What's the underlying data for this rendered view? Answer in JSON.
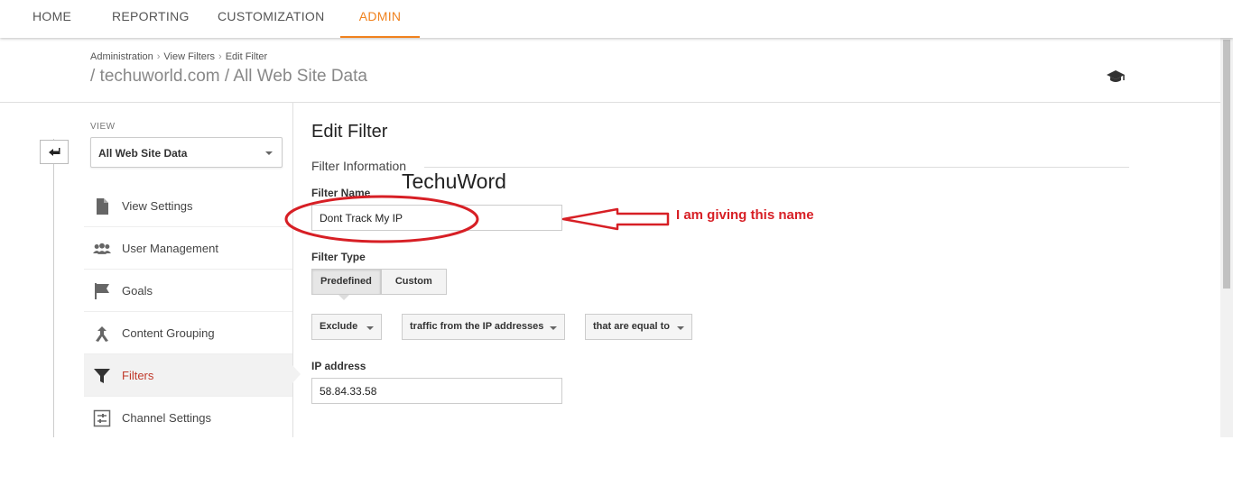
{
  "nav": {
    "tabs": [
      {
        "label": "HOME"
      },
      {
        "label": "REPORTING"
      },
      {
        "label": "CUSTOMIZATION"
      },
      {
        "label": "ADMIN"
      }
    ],
    "active_tab": "ADMIN",
    "accent_color": "#f0821e"
  },
  "header": {
    "breadcrumb": [
      "Administration",
      "View Filters",
      "Edit Filter"
    ],
    "account": "TechuWord",
    "property": "/ techuworld.com / All Web Site Data",
    "help_icon": "graduation-cap-icon"
  },
  "sidebar": {
    "back_icon": "back-arrow-icon",
    "view_label": "VIEW",
    "view_selected": "All Web Site Data",
    "items": [
      {
        "label": "View Settings",
        "icon": "document-icon"
      },
      {
        "label": "User Management",
        "icon": "users-icon"
      },
      {
        "label": "Goals",
        "icon": "flag-icon"
      },
      {
        "label": "Content Grouping",
        "icon": "content-grouping-icon"
      },
      {
        "label": "Filters",
        "icon": "funnel-icon",
        "active": true
      },
      {
        "label": "Channel Settings",
        "icon": "channel-settings-icon"
      }
    ],
    "active_color": "#c0392b"
  },
  "form": {
    "title": "Edit Filter",
    "section": "Filter Information",
    "filter_name_label": "Filter Name",
    "filter_name_value": "Dont Track My IP",
    "filter_type_label": "Filter Type",
    "filter_type_options": [
      "Predefined",
      "Custom"
    ],
    "filter_type_selected": "Predefined",
    "exclude_value": "Exclude",
    "source_value": "traffic from the IP addresses",
    "expression_value": "that are equal to",
    "ip_label": "IP address",
    "ip_value": "58.84.33.58"
  },
  "annotation": {
    "text": "I am giving this name",
    "color": "#d71f25"
  }
}
